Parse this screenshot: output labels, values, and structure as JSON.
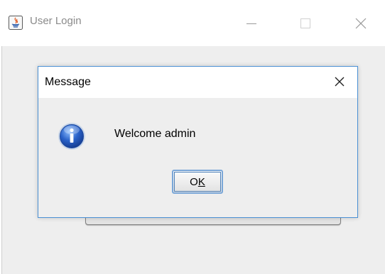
{
  "window": {
    "title": "User Login",
    "icon": "java-icon",
    "controls": [
      "minimize-icon",
      "maximize-icon",
      "close-icon"
    ]
  },
  "dialog": {
    "title": "Message",
    "icon": "info-icon",
    "message": "Welcome admin",
    "ok_label_first": "O",
    "ok_label_mnemonic": "K",
    "ok_label": "OK"
  },
  "colors": {
    "dialog_border": "#4a90d4",
    "body_bg": "#eeeeee",
    "titlebar_bg": "#ffffff",
    "info_blue": "#2a62c9"
  }
}
